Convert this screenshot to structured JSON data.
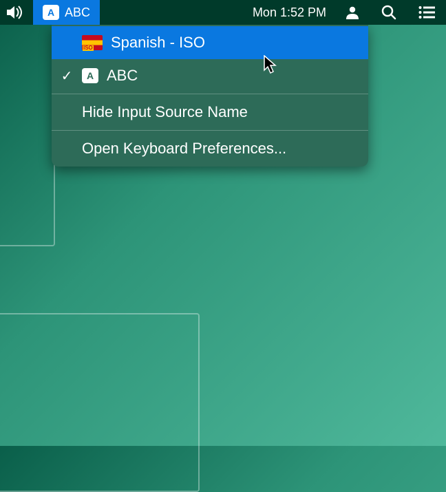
{
  "menubar": {
    "volume_icon": "volume",
    "input_source": {
      "badge": "A",
      "label": "ABC"
    },
    "datetime": "Mon 1:52 PM",
    "user_icon": "user",
    "search_icon": "search",
    "list_icon": "list"
  },
  "dropdown": {
    "items": [
      {
        "icon": "flag-es-iso",
        "label": "Spanish - ISO",
        "checked": false,
        "highlighted": true
      },
      {
        "icon": "abc",
        "label": "ABC",
        "checked": true,
        "highlighted": false
      }
    ],
    "actions": [
      {
        "label": "Hide Input Source Name"
      },
      {
        "label": "Open Keyboard Preferences..."
      }
    ]
  }
}
